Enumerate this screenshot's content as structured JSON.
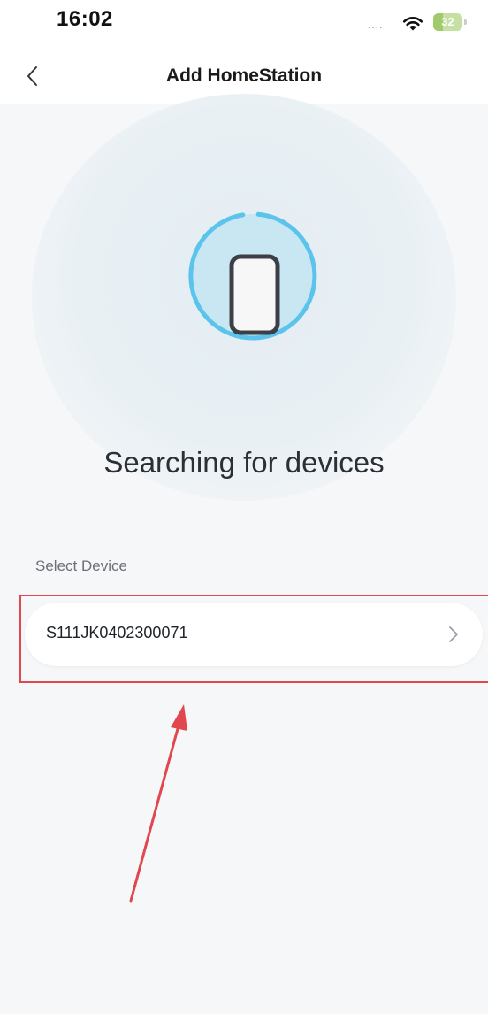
{
  "status_bar": {
    "time": "16:02",
    "signal": "....",
    "battery": "32",
    "battery_level": 0.32,
    "icons": [
      "wifi-icon",
      "battery-icon"
    ]
  },
  "nav": {
    "title": "Add HomeStation",
    "back_icon": "chevron-left-icon"
  },
  "search": {
    "status_text": "Searching for devices",
    "illustration_icon": "phone-icon",
    "accent_color": "#5cc4ec"
  },
  "devices": {
    "section_label": "Select Device",
    "items": [
      {
        "name": "S111JK0402300071",
        "icon": "chevron-right-icon"
      }
    ]
  },
  "annotation": {
    "color": "#e0474f"
  }
}
